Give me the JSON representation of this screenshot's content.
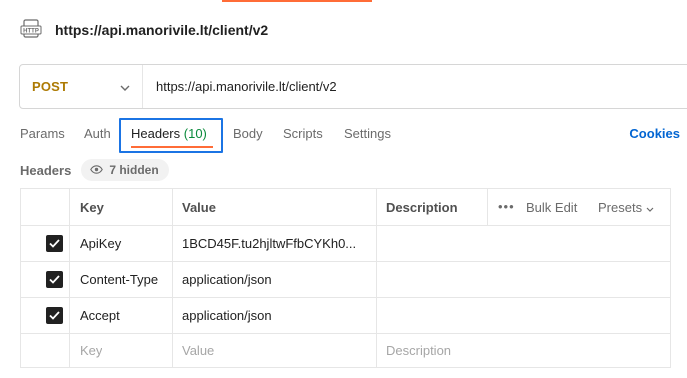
{
  "request": {
    "icon": "http-icon",
    "title": "https://api.manorivile.lt/client/v2"
  },
  "url_bar": {
    "method": "POST",
    "url": "https://api.manorivile.lt/client/v2"
  },
  "tabs": [
    {
      "label": "Params"
    },
    {
      "label": "Auth"
    },
    {
      "label": "Headers",
      "count": "(10)",
      "active": true
    },
    {
      "label": "Body"
    },
    {
      "label": "Scripts"
    },
    {
      "label": "Settings"
    }
  ],
  "cookies_label": "Cookies",
  "headers_section": {
    "label": "Headers",
    "hidden_label": "7 hidden"
  },
  "table": {
    "columns": [
      "Key",
      "Value",
      "Description"
    ],
    "bulk_edit": "Bulk Edit",
    "presets": "Presets",
    "rows": [
      {
        "checked": true,
        "key": "ApiKey",
        "value": "1BCD45F.tu2hjltwFfbCYKh0...",
        "description": ""
      },
      {
        "checked": true,
        "key": "Content-Type",
        "value": "application/json",
        "description": ""
      },
      {
        "checked": true,
        "key": "Accept",
        "value": "application/json",
        "description": ""
      }
    ],
    "placeholder": {
      "key": "Key",
      "value": "Value",
      "description": "Description"
    }
  },
  "colors": {
    "accent": "#ff6c37",
    "method_post": "#ad7a03",
    "highlight": "#1b74e4",
    "link": "#0265d2",
    "count": "#0b8a3c"
  }
}
